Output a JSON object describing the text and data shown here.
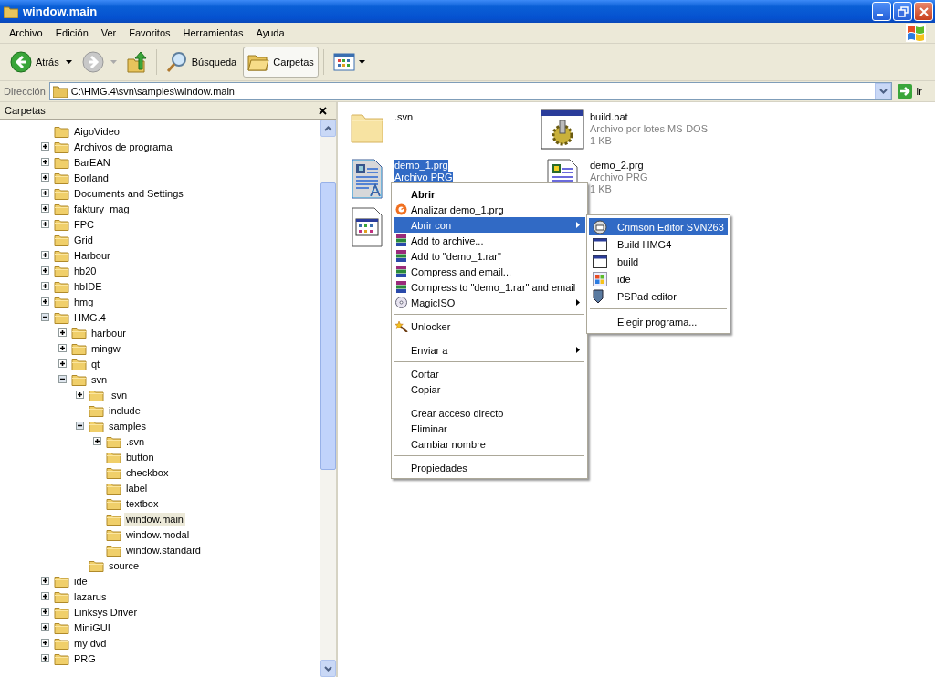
{
  "window": {
    "title": "window.main"
  },
  "menu_bar": [
    "Archivo",
    "Edición",
    "Ver",
    "Favoritos",
    "Herramientas",
    "Ayuda"
  ],
  "toolbar": {
    "back": {
      "label": "Atrás",
      "disabled": false
    },
    "forward": {
      "disabled": true
    },
    "search": {
      "label": "Búsqueda",
      "selected": false
    },
    "folders": {
      "label": "Carpetas",
      "selected": true
    }
  },
  "address_bar": {
    "label": "Dirección",
    "value": "C:\\HMG.4\\svn\\samples\\window.main",
    "go": "Ir"
  },
  "folders_panel": {
    "title": "Carpetas"
  },
  "tree": {
    "items": [
      {
        "name": "AigoVideo",
        "expandable": false,
        "selected": false
      },
      {
        "name": "Archivos de programa",
        "expandable": true,
        "expanded": false,
        "selected": false
      },
      {
        "name": "BarEAN",
        "expandable": true,
        "expanded": false,
        "selected": false
      },
      {
        "name": "Borland",
        "expandable": true,
        "expanded": false,
        "selected": false
      },
      {
        "name": "Documents and Settings",
        "expandable": true,
        "expanded": false,
        "selected": false
      },
      {
        "name": "faktury_mag",
        "expandable": true,
        "expanded": false,
        "selected": false
      },
      {
        "name": "FPC",
        "expandable": true,
        "expanded": false,
        "selected": false
      },
      {
        "name": "Grid",
        "expandable": false,
        "selected": false
      },
      {
        "name": "Harbour",
        "expandable": true,
        "expanded": false,
        "selected": false
      },
      {
        "name": "hb20",
        "expandable": true,
        "expanded": false,
        "selected": false
      },
      {
        "name": "hbIDE",
        "expandable": true,
        "expanded": false,
        "selected": false
      },
      {
        "name": "hmg",
        "expandable": true,
        "expanded": false,
        "selected": false
      },
      {
        "name": "HMG.4",
        "expandable": true,
        "expanded": true,
        "selected": false,
        "children": [
          {
            "name": "harbour",
            "expandable": true,
            "expanded": false,
            "selected": false
          },
          {
            "name": "mingw",
            "expandable": true,
            "expanded": false,
            "selected": false
          },
          {
            "name": "qt",
            "expandable": true,
            "expanded": false,
            "selected": false
          },
          {
            "name": "svn",
            "expandable": true,
            "expanded": true,
            "selected": false,
            "children": [
              {
                "name": ".svn",
                "expandable": true,
                "expanded": false,
                "selected": false
              },
              {
                "name": "include",
                "expandable": false,
                "selected": false
              },
              {
                "name": "samples",
                "expandable": true,
                "expanded": true,
                "selected": false,
                "children": [
                  {
                    "name": ".svn",
                    "expandable": true,
                    "expanded": false,
                    "selected": false
                  },
                  {
                    "name": "button",
                    "expandable": false,
                    "selected": false
                  },
                  {
                    "name": "checkbox",
                    "expandable": false,
                    "selected": false
                  },
                  {
                    "name": "label",
                    "expandable": false,
                    "selected": false
                  },
                  {
                    "name": "textbox",
                    "expandable": false,
                    "selected": false
                  },
                  {
                    "name": "window.main",
                    "expandable": false,
                    "selected": true
                  },
                  {
                    "name": "window.modal",
                    "expandable": false,
                    "selected": false
                  },
                  {
                    "name": "window.standard",
                    "expandable": false,
                    "selected": false
                  }
                ]
              },
              {
                "name": "source",
                "expandable": false,
                "selected": false
              }
            ]
          }
        ]
      },
      {
        "name": "ide",
        "expandable": true,
        "expanded": false,
        "selected": false
      },
      {
        "name": "lazarus",
        "expandable": true,
        "expanded": false,
        "selected": false
      },
      {
        "name": "Linksys Driver",
        "expandable": true,
        "expanded": false,
        "selected": false
      },
      {
        "name": "MiniGUI",
        "expandable": true,
        "expanded": false,
        "selected": false
      },
      {
        "name": "my dvd",
        "expandable": true,
        "expanded": false,
        "selected": false
      },
      {
        "name": "PRG",
        "expandable": true,
        "expanded": false,
        "selected": false
      }
    ]
  },
  "files": [
    {
      "kind": "folder",
      "name": ".svn",
      "selected": false
    },
    {
      "kind": "batch",
      "name": "build.bat",
      "type": "Archivo por lotes MS-DOS",
      "size": "1 KB",
      "selected": false
    },
    {
      "kind": "prg",
      "name": "demo_1.prg",
      "type": "Archivo PRG",
      "selected": true
    },
    {
      "kind": "prg",
      "name": "demo_2.prg",
      "type": "Archivo PRG",
      "size": "1 KB",
      "selected": false
    },
    {
      "kind": "exe",
      "selected": false
    }
  ],
  "context_menu": {
    "items": [
      {
        "kind": "item",
        "label": "Abrir",
        "default": true,
        "submenu": false,
        "highlighted": false
      },
      {
        "kind": "item",
        "label": "Analizar demo_1.prg",
        "default": false,
        "submenu": false,
        "highlighted": false
      },
      {
        "kind": "item",
        "label": "Abrir con",
        "default": false,
        "submenu": true,
        "highlighted": true
      },
      {
        "kind": "item",
        "label": "Add to archive...",
        "default": false,
        "submenu": false,
        "highlighted": false
      },
      {
        "kind": "item",
        "label": "Add to \"demo_1.rar\"",
        "default": false,
        "submenu": false,
        "highlighted": false
      },
      {
        "kind": "item",
        "label": "Compress and email...",
        "default": false,
        "submenu": false,
        "highlighted": false
      },
      {
        "kind": "item",
        "label": "Compress to \"demo_1.rar\" and email",
        "default": false,
        "submenu": false,
        "highlighted": false
      },
      {
        "kind": "item",
        "label": "MagicISO",
        "default": false,
        "submenu": true,
        "highlighted": false
      },
      {
        "kind": "separator"
      },
      {
        "kind": "item",
        "label": "Unlocker",
        "default": false,
        "submenu": false,
        "highlighted": false
      },
      {
        "kind": "separator"
      },
      {
        "kind": "item",
        "label": "Enviar a",
        "default": false,
        "submenu": true,
        "highlighted": false
      },
      {
        "kind": "separator"
      },
      {
        "kind": "item",
        "label": "Cortar",
        "default": false,
        "submenu": false,
        "highlighted": false
      },
      {
        "kind": "item",
        "label": "Copiar",
        "default": false,
        "submenu": false,
        "highlighted": false
      },
      {
        "kind": "separator"
      },
      {
        "kind": "item",
        "label": "Crear acceso directo",
        "default": false,
        "submenu": false,
        "highlighted": false
      },
      {
        "kind": "item",
        "label": "Eliminar",
        "default": false,
        "submenu": false,
        "highlighted": false
      },
      {
        "kind": "item",
        "label": "Cambiar nombre",
        "default": false,
        "submenu": false,
        "highlighted": false
      },
      {
        "kind": "separator"
      },
      {
        "kind": "item",
        "label": "Propiedades",
        "default": false,
        "submenu": false,
        "highlighted": false
      }
    ]
  },
  "open_with_menu": {
    "items": [
      {
        "kind": "item",
        "label": "Crimson Editor SVN263",
        "highlighted": true
      },
      {
        "kind": "item",
        "label": "Build HMG4",
        "highlighted": false
      },
      {
        "kind": "item",
        "label": "build",
        "highlighted": false
      },
      {
        "kind": "item",
        "label": "ide",
        "highlighted": false
      },
      {
        "kind": "item",
        "label": "PSPad editor",
        "highlighted": false
      },
      {
        "kind": "separator"
      },
      {
        "kind": "item",
        "label": "Elegir programa...",
        "highlighted": false
      }
    ]
  }
}
